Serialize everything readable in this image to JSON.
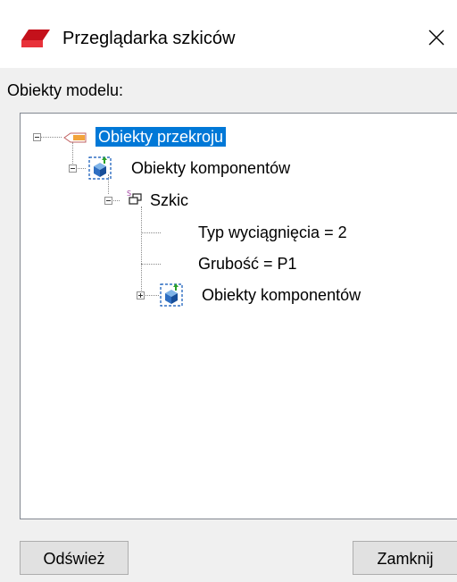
{
  "window": {
    "title": "Przeglądarka szkiców",
    "app_icon": "red-flag-app-icon",
    "close_icon": "close-icon"
  },
  "section_label": "Obiekty modelu:",
  "tree": {
    "root": {
      "label": "Obiekty przekroju",
      "icon": "section-icon",
      "expanded": true,
      "selected": true
    },
    "components_1": {
      "label": "Obiekty komponentów",
      "icon": "component-objects-icon",
      "expanded": true
    },
    "sketch": {
      "label": "Szkic",
      "icon": "sketch-icon",
      "badge": "S",
      "expanded": true
    },
    "extrusion_type": {
      "label": "Typ wyciągnięcia = 2"
    },
    "thickness": {
      "label": "Grubość = P1"
    },
    "components_2": {
      "label": "Obiekty komponentów",
      "icon": "component-objects-icon",
      "expanded": false
    }
  },
  "buttons": {
    "refresh": "Odśwież",
    "close": "Zamknij"
  },
  "colors": {
    "selection": "#0078d7",
    "dialog_background": "#f0f0f0",
    "button_face": "#e1e1e1"
  }
}
